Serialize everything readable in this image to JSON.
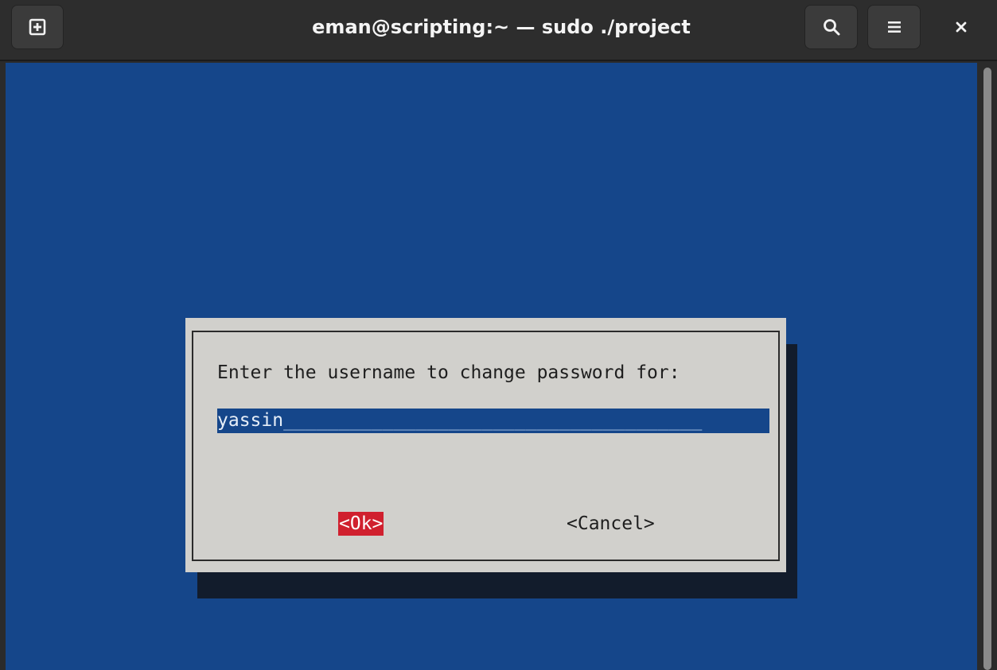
{
  "window": {
    "title": "eman@scripting:~ — sudo ./project"
  },
  "titlebar": {
    "new_tab_icon": "plus-square-icon",
    "search_icon": "search-icon",
    "menu_icon": "hamburger-menu-icon",
    "close_icon": "close-icon"
  },
  "dialog": {
    "prompt": "Enter the username to change password for:",
    "input_value": "yassin",
    "input_fill": "______________________________________",
    "ok_label": "<Ok>",
    "cancel_label": "<Cancel>"
  },
  "colors": {
    "terminal_background": "#15468a",
    "dialog_background": "#d1d0cc",
    "ok_highlight": "#d0202e",
    "titlebar": "#2d2d2d"
  }
}
